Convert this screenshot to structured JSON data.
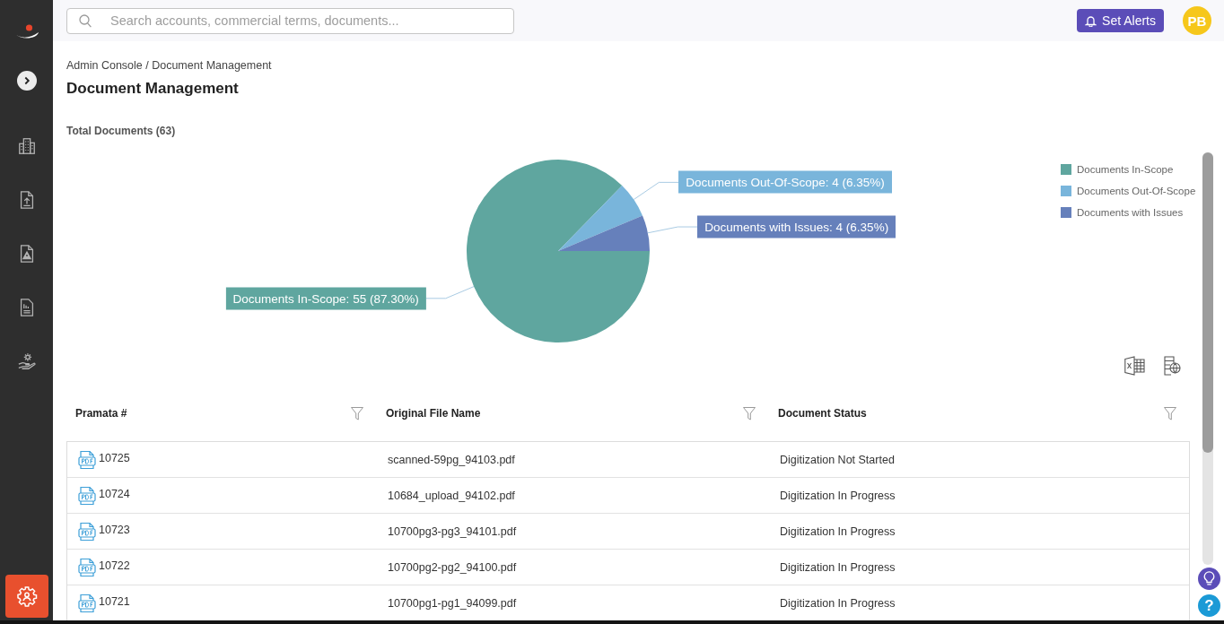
{
  "sidebar": {
    "items": [
      {
        "selected": false
      },
      {
        "selected": false
      },
      {
        "selected": false
      },
      {
        "selected": false
      },
      {
        "selected": false
      }
    ],
    "footer_items": [
      {
        "selected": true
      }
    ]
  },
  "top_bar": {
    "search": {
      "placeholder": "Search accounts, commercial terms, documents..."
    },
    "alerts_button": "Set Alerts",
    "avatar": "PB"
  },
  "page": {
    "breadcrumb": "Admin Console / Document Management",
    "title": "Document Management"
  },
  "summary": {
    "chart_data": {
      "type": "pie",
      "title": "Total Documents (63)",
      "categories": [
        "Documents In-Scope",
        "Documents Out-Of-Scope",
        "Documents with Issues"
      ],
      "values": [
        55,
        4,
        4
      ],
      "colors": [
        "#5fa69f",
        "#79b5db",
        "#6680bb"
      ],
      "value_labels": [
        "Documents In-Scope: 55 (87.30%)",
        "Documents Out-Of-Scope: 4 (6.35%)",
        "Documents with Issues: 4 (6.35%)"
      ]
    }
  },
  "table": {
    "columns": [
      "Pramata #",
      "Original File Name",
      "Document Status"
    ],
    "rows": [
      [
        "10725",
        "scanned-59pg_94103.pdf",
        "Digitization Not Started"
      ],
      [
        "10724",
        "10684_upload_94102.pdf",
        "Digitization In Progress"
      ],
      [
        "10723",
        "10700pg3-pg3_94101.pdf",
        "Digitization In Progress"
      ],
      [
        "10722",
        "10700pg2-pg2_94100.pdf",
        "Digitization In Progress"
      ],
      [
        "10721",
        "10700pg1-pg1_94099.pdf",
        "Digitization In Progress"
      ]
    ]
  },
  "help_button": "?"
}
